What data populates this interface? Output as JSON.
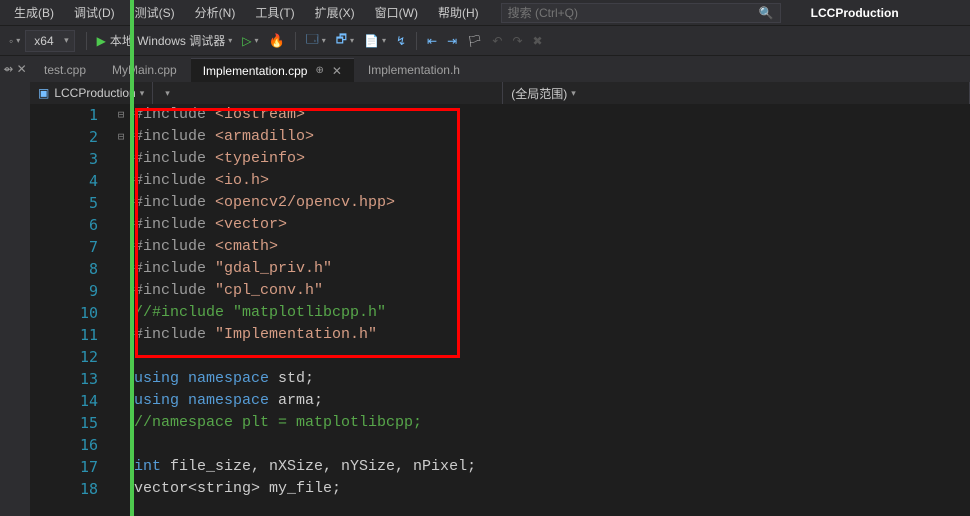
{
  "menu": {
    "items": [
      "生成(B)",
      "调试(D)",
      "测试(S)",
      "分析(N)",
      "工具(T)",
      "扩展(X)",
      "窗口(W)",
      "帮助(H)"
    ],
    "search_placeholder": "搜索 (Ctrl+Q)",
    "solution": "LCCProduction"
  },
  "toolbar": {
    "platform": "x64",
    "run_label": "本地 Windows 调试器"
  },
  "tabs": [
    {
      "label": "test.cpp",
      "active": false
    },
    {
      "label": "MyMain.cpp",
      "active": false
    },
    {
      "label": "Implementation.cpp",
      "active": true
    },
    {
      "label": "Implementation.h",
      "active": false
    }
  ],
  "navbar": {
    "project": "LCCProduction",
    "scope": "(全局范围)"
  },
  "code_lines": [
    {
      "n": 1,
      "html": "<span class='pp'>#include</span> <span class='str'>&lt;iostream&gt;</span>",
      "fold": "⊟"
    },
    {
      "n": 2,
      "html": "<span class='pp'>#include</span> <span class='str'>&lt;armadillo&gt;</span>"
    },
    {
      "n": 3,
      "html": "<span class='pp'>#include</span> <span class='str'>&lt;typeinfo&gt;</span>"
    },
    {
      "n": 4,
      "html": "<span class='pp'>#include</span> <span class='str'>&lt;io.h&gt;</span>"
    },
    {
      "n": 5,
      "html": "<span class='pp'>#include</span> <span class='str'>&lt;opencv2/opencv.hpp&gt;</span>"
    },
    {
      "n": 6,
      "html": "<span class='pp'>#include</span> <span class='str'>&lt;vector&gt;</span>"
    },
    {
      "n": 7,
      "html": "<span class='pp'>#include</span> <span class='str'>&lt;cmath&gt;</span>"
    },
    {
      "n": 8,
      "html": "<span class='pp'>#include</span> <span class='str'>\"gdal_priv.h\"</span>"
    },
    {
      "n": 9,
      "html": "<span class='pp'>#include</span> <span class='str'>\"cpl_conv.h\"</span>"
    },
    {
      "n": 10,
      "html": "<span class='cmt'>//#include \"matplotlibcpp.h\"</span>"
    },
    {
      "n": 11,
      "html": "<span class='pp'>#include</span> <span class='str'>\"Implementation.h\"</span>"
    },
    {
      "n": 12,
      "html": ""
    },
    {
      "n": 13,
      "html": "<span class='kw'>using</span> <span class='kw'>namespace</span> std;",
      "fold": "⊟"
    },
    {
      "n": 14,
      "html": "<span class='kw'>using</span> <span class='kw'>namespace</span> arma;"
    },
    {
      "n": 15,
      "html": "<span class='cmt'>//namespace plt = matplotlibcpp;</span>"
    },
    {
      "n": 16,
      "html": ""
    },
    {
      "n": 17,
      "html": "<span class='typ'>int</span> file_size, nXSize, nYSize, nPixel;"
    },
    {
      "n": 18,
      "html": "vector&lt;string&gt; my_file;"
    }
  ]
}
